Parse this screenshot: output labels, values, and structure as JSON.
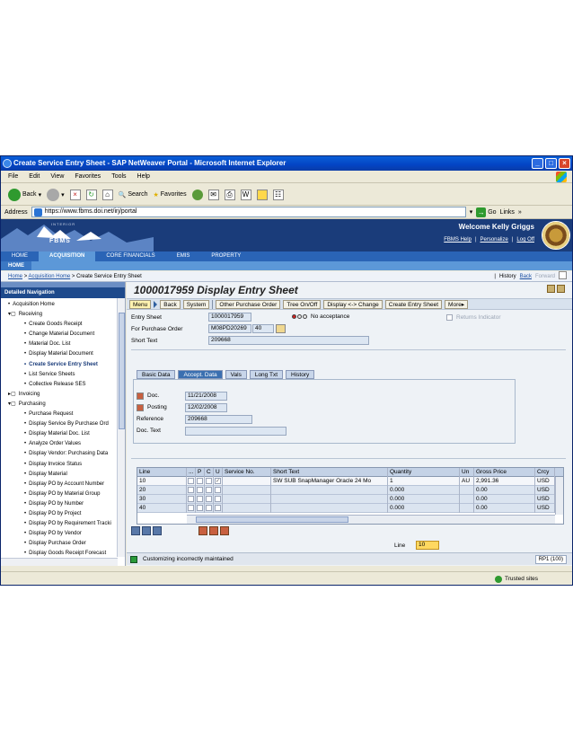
{
  "window": {
    "title": "Create Service Entry Sheet - SAP NetWeaver Portal - Microsoft Internet Explorer"
  },
  "menubar": [
    "File",
    "Edit",
    "View",
    "Favorites",
    "Tools",
    "Help"
  ],
  "toolbar": {
    "back": "Back",
    "search": "Search",
    "favorites": "Favorites"
  },
  "address": {
    "label": "Address",
    "url": "https://www.fbms.doi.net/irj/portal",
    "go": "Go",
    "links": "Links"
  },
  "portal": {
    "interior": "INTERIOR",
    "logo": "FBMS",
    "welcome": "Welcome Kelly Griggs",
    "links": [
      "FBMS Help",
      "Personalize",
      "Log Off"
    ]
  },
  "tabs": [
    "HOME",
    "ACQUISITION",
    "CORE FINANCIALS",
    "EMIS",
    "PROPERTY"
  ],
  "subtab": "HOME",
  "breadcrumb": {
    "items": [
      "Home",
      "Acquisition Home",
      "Create Service Entry Sheet"
    ],
    "separator": ">",
    "history": "History",
    "back": "Back",
    "forward": "Forward"
  },
  "nav": {
    "header": "Detailed Navigation",
    "items": [
      {
        "label": "Acquisition Home",
        "level": 1,
        "bullet": "•"
      },
      {
        "label": "Receiving",
        "level": 1,
        "bullet": "▾▢"
      },
      {
        "label": "Create Goods Receipt",
        "level": 2,
        "bullet": "•"
      },
      {
        "label": "Change Material Document",
        "level": 2,
        "bullet": "•"
      },
      {
        "label": "Material Doc. List",
        "level": 2,
        "bullet": "•"
      },
      {
        "label": "Display Material Document",
        "level": 2,
        "bullet": "•"
      },
      {
        "label": "Create Service Entry Sheet",
        "level": 2,
        "bullet": "•",
        "selected": true
      },
      {
        "label": "List Service Sheets",
        "level": 2,
        "bullet": "•"
      },
      {
        "label": "Collective Release SES",
        "level": 2,
        "bullet": "•"
      },
      {
        "label": "Invoicing",
        "level": 1,
        "bullet": "▸▢"
      },
      {
        "label": "Purchasing",
        "level": 1,
        "bullet": "▾▢"
      },
      {
        "label": "Purchase Request",
        "level": 2,
        "bullet": "•"
      },
      {
        "label": "Display Service By Purchase Ord",
        "level": 2,
        "bullet": "•"
      },
      {
        "label": "Display Material Doc. List",
        "level": 2,
        "bullet": "•"
      },
      {
        "label": "Analyze Order Values",
        "level": 2,
        "bullet": "•"
      },
      {
        "label": "Display Vendor: Purchasing Data",
        "level": 2,
        "bullet": "•"
      },
      {
        "label": "Display Invoice Status",
        "level": 2,
        "bullet": "•"
      },
      {
        "label": "Display Material",
        "level": 2,
        "bullet": "•"
      },
      {
        "label": "Display PO by Account Number",
        "level": 2,
        "bullet": "•"
      },
      {
        "label": "Display PO by Material Group",
        "level": 2,
        "bullet": "•"
      },
      {
        "label": "Display PO by Number",
        "level": 2,
        "bullet": "•"
      },
      {
        "label": "Display PO by Project",
        "level": 2,
        "bullet": "•"
      },
      {
        "label": "Display PO by Requirement Tracki",
        "level": 2,
        "bullet": "•"
      },
      {
        "label": "Display PO by Vendor",
        "level": 2,
        "bullet": "•"
      },
      {
        "label": "Display Purchase Order",
        "level": 2,
        "bullet": "•"
      },
      {
        "label": "Display Goods Receipt Forecast",
        "level": 2,
        "bullet": "•"
      }
    ]
  },
  "sap": {
    "title": "1000017959 Display Entry Sheet",
    "buttons": [
      "Menu",
      "Back",
      "System",
      "Other Purchase Order",
      "Tree On/Off",
      "Display <-> Change",
      "Create Entry Sheet",
      "More"
    ],
    "entry_sheet_label": "Entry Sheet",
    "entry_sheet_value": "1000017959",
    "acceptance": "No acceptance",
    "returns_indicator": "Returns Indicator",
    "po_label": "For Purchase Order",
    "po_value": "M08PD20269",
    "po_item": "40",
    "short_text_label": "Short Text",
    "short_text_value": "209668",
    "detail_tabs": [
      "Basic Data",
      "Accept. Data",
      "Vals",
      "Long Txt",
      "History"
    ],
    "active_detail_tab": "Accept. Data",
    "doc_label": "Doc.",
    "doc_date": "11/21/2008",
    "posting_label": "Posting",
    "posting_date": "12/02/2008",
    "reference_label": "Reference",
    "reference_value": "209668",
    "doctext_label": "Doc. Text",
    "doctext_value": "",
    "grid": {
      "columns": [
        "Line",
        "...",
        "P",
        "C",
        "U",
        "Service No.",
        "Short Text",
        "Quantity",
        "Un",
        "Gross Price",
        "Crcy"
      ],
      "rows": [
        {
          "line": "10",
          "short_text": "SW SUB SnapManager Oracle 24 Mo",
          "quantity": "1",
          "unit": "AU",
          "price": "2,991.36",
          "currency": "USD",
          "check": "✓"
        },
        {
          "line": "20",
          "short_text": "",
          "quantity": "0.000",
          "unit": "",
          "price": "0.00",
          "currency": "USD",
          "check": ""
        },
        {
          "line": "30",
          "short_text": "",
          "quantity": "0.000",
          "unit": "",
          "price": "0.00",
          "currency": "USD",
          "check": ""
        },
        {
          "line": "40",
          "short_text": "",
          "quantity": "0.000",
          "unit": "",
          "price": "0.00",
          "currency": "USD",
          "check": ""
        }
      ]
    },
    "line_label": "Line",
    "line_value": "10",
    "status_message": "Customizing incorrectly maintained",
    "system": "RP1 (100)"
  },
  "iestatus": {
    "zone": "Trusted sites"
  }
}
